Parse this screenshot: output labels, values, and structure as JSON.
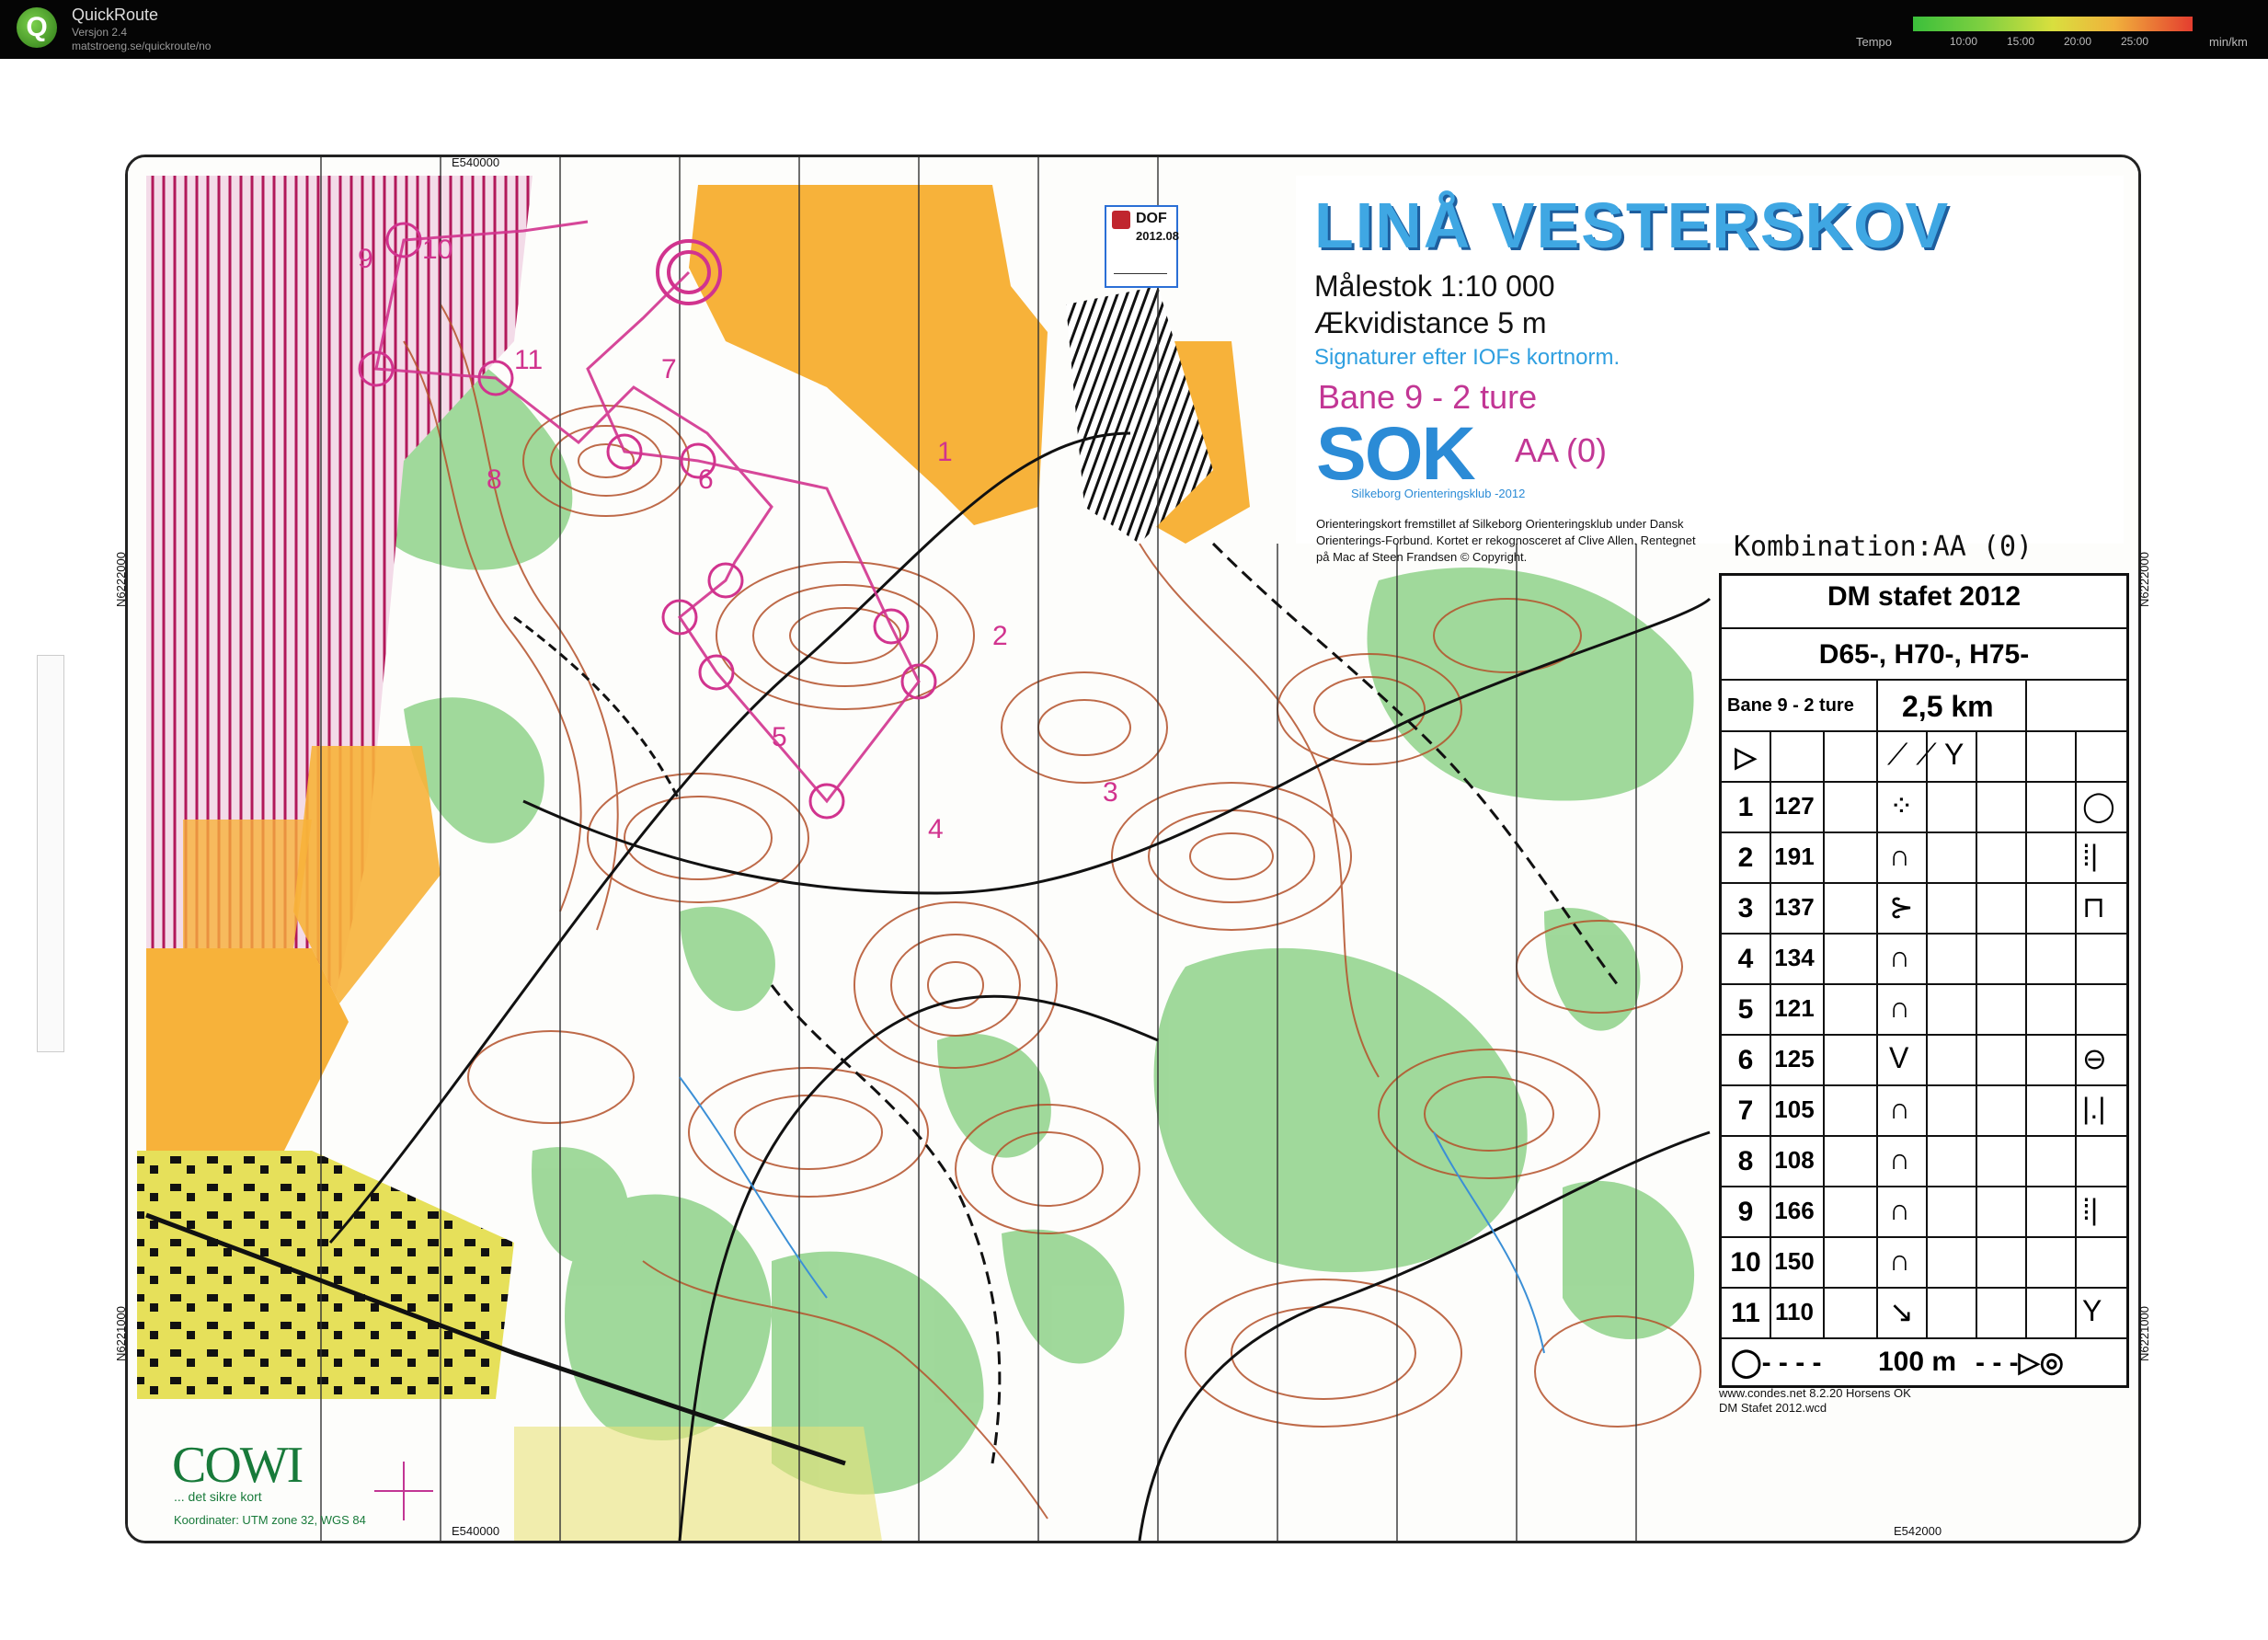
{
  "app": {
    "name": "QuickRoute",
    "version": "Versjon 2.4",
    "url": "matstroeng.se/quickroute/no",
    "tempo_label": "Tempo",
    "tempo_ticks": [
      "10:00",
      "15:00",
      "20:00",
      "25:00"
    ],
    "tempo_unit": "min/km"
  },
  "map": {
    "title": "LINÅ VESTERSKOV",
    "scale": "Målestok 1:10 000",
    "contour": "Ækvidistance 5 m",
    "symbols_note": "Signaturer efter IOFs kortnorm.",
    "course": "Bane 9 - 2 ture",
    "club_logo": "SOK",
    "club_name": "Silkeborg Orienteringsklub -2012",
    "combination_short": "AA (0)",
    "credit": "Orienteringskort fremstillet af Silkeborg Orienteringsklub under Dansk Orienterings-Forbund. Kortet er rekognosceret af Clive Allen. Rentegnet på Mac af Steen Frandsen        © Copyright.",
    "dof_badge": {
      "org": "DOF",
      "code": "2012.08"
    },
    "combination": "Kombination:AA (0)",
    "grid_labels": {
      "top": "E540000",
      "bottom_left": "E540000",
      "bottom_right": "E542000",
      "left_top": "N6222000",
      "left_bottom": "N6221000",
      "right_top": "N6222000",
      "right_bottom": "N6221000"
    },
    "cowi": {
      "logo": "COWI",
      "tagline": "... det sikre kort",
      "coords": "Koordinater: UTM zone 32, WGS 84"
    },
    "condes": [
      "www.condes.net 8.2.20 Horsens OK",
      "DM Stafet 2012.wcd"
    ],
    "control_labels": [
      "1",
      "2",
      "3",
      "4",
      "5",
      "6",
      "7",
      "8",
      "9",
      "10",
      "11"
    ]
  },
  "control_description": {
    "event": "DM stafet 2012",
    "classes": "D65-, H70-, H75-",
    "course": "Bane 9 - 2 ture",
    "length": "2,5 km",
    "controls": [
      {
        "num": "1",
        "code": "127",
        "feature": "⁘",
        "extra": "◯"
      },
      {
        "num": "2",
        "code": "191",
        "feature": "∩",
        "extra": "⁞|"
      },
      {
        "num": "3",
        "code": "137",
        "feature": "⊱",
        "extra": "⊓"
      },
      {
        "num": "4",
        "code": "134",
        "feature": "∩",
        "extra": ""
      },
      {
        "num": "5",
        "code": "121",
        "feature": "∩",
        "extra": ""
      },
      {
        "num": "6",
        "code": "125",
        "feature": "V",
        "extra": "⊖"
      },
      {
        "num": "7",
        "code": "105",
        "feature": "∩",
        "extra": "|.|"
      },
      {
        "num": "8",
        "code": "108",
        "feature": "∩",
        "extra": ""
      },
      {
        "num": "9",
        "code": "166",
        "feature": "∩",
        "extra": "⁞|"
      },
      {
        "num": "10",
        "code": "150",
        "feature": "∩",
        "extra": ""
      },
      {
        "num": "11",
        "code": "110",
        "feature": "↘",
        "extra": "Y"
      }
    ],
    "finish_text": "100 m"
  },
  "colors": {
    "forest_green": "#5fbf5f",
    "open_yellow": "#f7b23a",
    "contour_brown": "#b4512a",
    "course_magenta": "#d1338e",
    "title_blue": "#3fa7e3"
  }
}
